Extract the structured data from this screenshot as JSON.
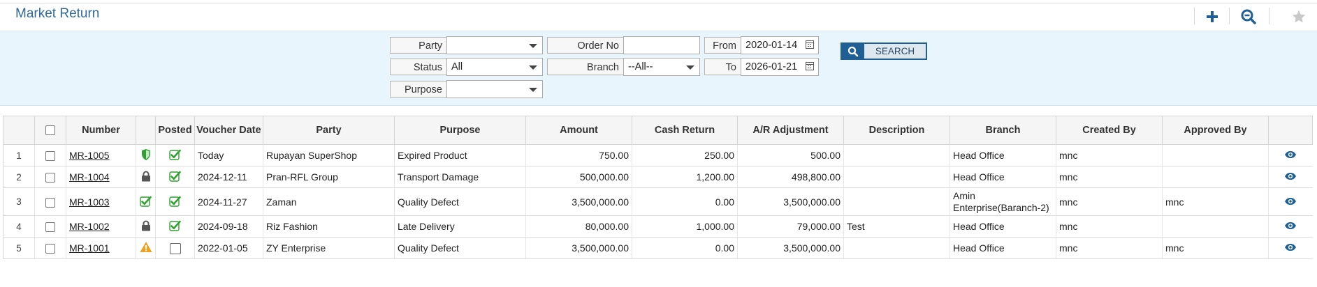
{
  "page": {
    "title": "Market Return"
  },
  "toolbar": {
    "add_icon": "plus-icon",
    "zoom_icon": "zoom-out-icon",
    "fav_icon": "star-icon"
  },
  "filters": {
    "party_label": "Party",
    "party_value": "",
    "order_label": "Order No",
    "order_value": "",
    "from_label": "From",
    "from_value": "2020-01-14",
    "status_label": "Status",
    "status_value": "All",
    "branch_label": "Branch",
    "branch_value": "--All--",
    "to_label": "To",
    "to_value": "2026-01-21",
    "purpose_label": "Purpose",
    "purpose_value": "",
    "search_label": "SEARCH"
  },
  "table": {
    "headers": {
      "number": "Number",
      "posted": "Posted",
      "voucher_date": "Voucher Date",
      "party": "Party",
      "purpose": "Purpose",
      "amount": "Amount",
      "cash_return": "Cash Return",
      "ar_adjustment": "A/R Adjustment",
      "description": "Description",
      "branch": "Branch",
      "created_by": "Created By",
      "approved_by": "Approved By"
    },
    "rows": [
      {
        "rn": "1",
        "number": "MR-1005",
        "status_icon": "shield-icon",
        "posted": true,
        "date": "Today",
        "party": "Rupayan SuperShop",
        "purpose": "Expired Product",
        "amount": "750.00",
        "cash_return": "250.00",
        "ar_adjustment": "500.00",
        "description": "",
        "branch": "Head Office",
        "created_by": "mnc",
        "approved_by": ""
      },
      {
        "rn": "2",
        "number": "MR-1004",
        "status_icon": "lock-icon",
        "posted": true,
        "date": "2024-12-11",
        "party": "Pran-RFL Group",
        "purpose": "Transport Damage",
        "amount": "500,000.00",
        "cash_return": "1,200.00",
        "ar_adjustment": "498,800.00",
        "description": "",
        "branch": "Head Office",
        "created_by": "mnc",
        "approved_by": ""
      },
      {
        "rn": "3",
        "number": "MR-1003",
        "status_icon": "check-icon",
        "posted": true,
        "date": "2024-11-27",
        "party": "Zaman",
        "purpose": "Quality Defect",
        "amount": "3,500,000.00",
        "cash_return": "0.00",
        "ar_adjustment": "3,500,000.00",
        "description": "",
        "branch": "Amin Enterprise(Baranch-2)",
        "created_by": "mnc",
        "approved_by": "mnc"
      },
      {
        "rn": "4",
        "number": "MR-1002",
        "status_icon": "lock-icon",
        "posted": true,
        "date": "2024-09-18",
        "party": "Riz Fashion",
        "purpose": "Late Delivery",
        "amount": "80,000.00",
        "cash_return": "1,000.00",
        "ar_adjustment": "79,000.00",
        "description": "Test",
        "branch": "Head Office",
        "created_by": "mnc",
        "approved_by": ""
      },
      {
        "rn": "5",
        "number": "MR-1001",
        "status_icon": "warning-icon",
        "posted": false,
        "date": "2022-01-05",
        "party": "ZY Enterprise",
        "purpose": "Quality Defect",
        "amount": "3,500,000.00",
        "cash_return": "0.00",
        "ar_adjustment": "3,500,000.00",
        "description": "",
        "branch": "Head Office",
        "created_by": "mnc",
        "approved_by": "mnc"
      }
    ]
  },
  "colors": {
    "accent": "#1f5f93",
    "title": "#2f6a99",
    "filter_bg": "#e9f5fd",
    "success": "#26a526",
    "warning": "#f0a020"
  }
}
